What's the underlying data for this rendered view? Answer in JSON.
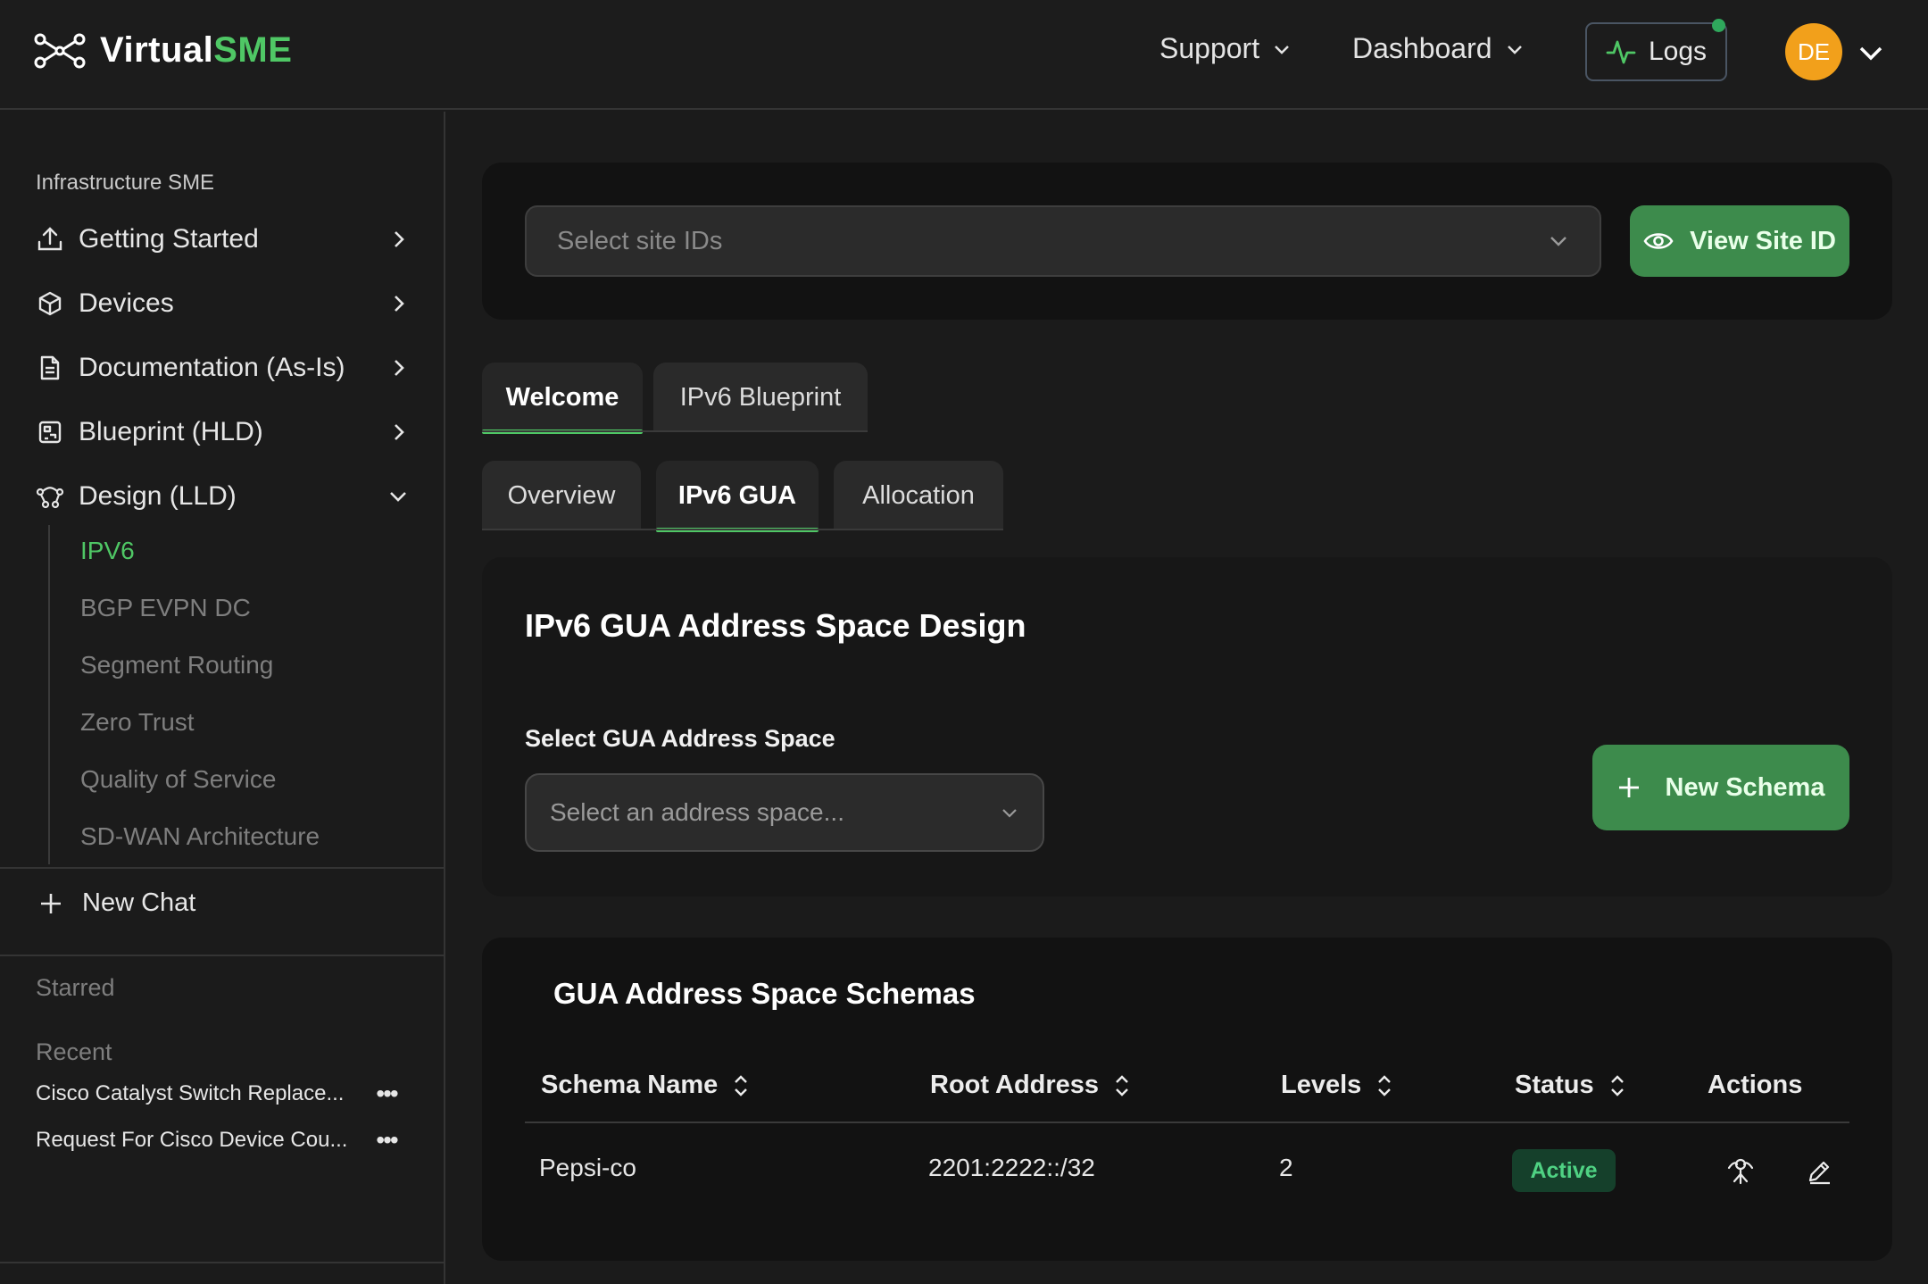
{
  "header": {
    "brand_prefix": "Virtual",
    "brand_accent": "SME",
    "nav": [
      {
        "label": "Support"
      },
      {
        "label": "Dashboard"
      }
    ],
    "logs_label": "Logs",
    "avatar_initials": "DE"
  },
  "sidebar": {
    "section_title": "Infrastructure SME",
    "items": [
      {
        "label": "Getting Started",
        "icon": "upload-icon"
      },
      {
        "label": "Devices",
        "icon": "cube-icon"
      },
      {
        "label": "Documentation (As-Is)",
        "icon": "document-icon"
      },
      {
        "label": "Blueprint (HLD)",
        "icon": "blueprint-icon"
      },
      {
        "label": "Design (LLD)",
        "icon": "network-design-icon",
        "expanded": true
      }
    ],
    "design_subitems": [
      {
        "label": "IPV6",
        "active": true
      },
      {
        "label": "BGP EVPN DC"
      },
      {
        "label": "Segment Routing"
      },
      {
        "label": "Zero Trust"
      },
      {
        "label": "Quality of Service"
      },
      {
        "label": "SD-WAN Architecture"
      }
    ],
    "new_chat_label": "New Chat",
    "starred_label": "Starred",
    "recent_label": "Recent",
    "recent_items": [
      {
        "label": "Cisco Catalyst Switch Replace..."
      },
      {
        "label": "Request For Cisco Device Cou..."
      }
    ]
  },
  "site_bar": {
    "placeholder": "Select site IDs",
    "view_button": "View Site ID"
  },
  "tabs_primary": [
    {
      "label": "Welcome",
      "active": true
    },
    {
      "label": "IPv6 Blueprint"
    }
  ],
  "tabs_secondary": [
    {
      "label": "Overview"
    },
    {
      "label": "IPv6 GUA",
      "active": true
    },
    {
      "label": "Allocation"
    }
  ],
  "design": {
    "title": "IPv6 GUA Address Space Design",
    "select_label": "Select GUA Address Space",
    "select_placeholder": "Select an address space...",
    "new_schema_button": "New Schema"
  },
  "schemas": {
    "title": "GUA Address Space Schemas",
    "columns": [
      "Schema Name",
      "Root Address",
      "Levels",
      "Status",
      "Actions"
    ],
    "rows": [
      {
        "name": "Pepsi-co",
        "root_address": "2201:2222::/32",
        "levels": "2",
        "status": "Active"
      }
    ]
  },
  "colors": {
    "accent_green": "#4fc765",
    "button_green": "#3d8b4c",
    "avatar_orange": "#f2a01b",
    "status_active_text": "#4fd283",
    "status_active_bg": "#15402b"
  }
}
